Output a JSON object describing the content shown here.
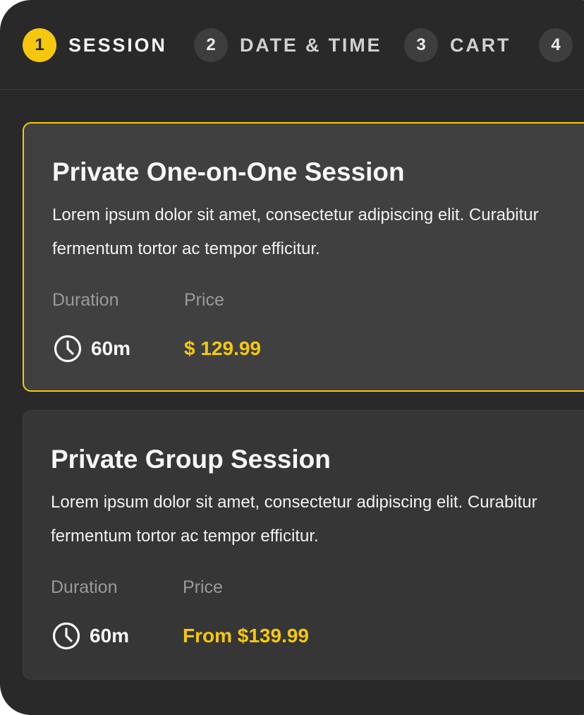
{
  "steps": [
    {
      "number": "1",
      "label": "SESSION",
      "active": true
    },
    {
      "number": "2",
      "label": "DATE & TIME",
      "active": false
    },
    {
      "number": "3",
      "label": "CART",
      "active": false
    },
    {
      "number": "4",
      "label": "",
      "active": false
    }
  ],
  "sessions": [
    {
      "title": "Private One-on-One Session",
      "description": "Lorem ipsum dolor sit amet, consectetur adipiscing elit. Curabitur fermentum tortor ac tempor efficitur.",
      "duration_label": "Duration",
      "duration_value": "60m",
      "price_label": "Price",
      "price_value": "$ 129.99",
      "selected": true
    },
    {
      "title": "Private Group Session",
      "description": "Lorem ipsum dolor sit amet, consectetur adipiscing elit. Curabitur fermentum tortor ac tempor efficitur.",
      "duration_label": "Duration",
      "duration_value": "60m",
      "price_label": "Price",
      "price_value": "From $139.99",
      "selected": false
    }
  ],
  "icons": {
    "duration": "clock-icon"
  },
  "colors": {
    "background": "#292929",
    "accent": "#f5c80e",
    "card_selected": "#404040",
    "card": "#363636",
    "step_inactive": "#3e3e3e",
    "muted_text": "#9a9a9a"
  }
}
